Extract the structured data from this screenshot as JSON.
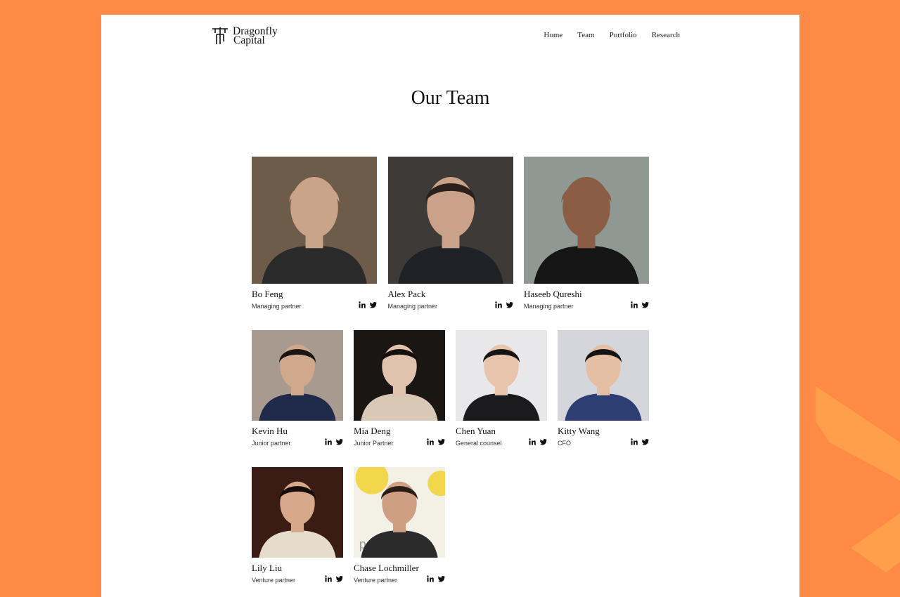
{
  "brand": {
    "line1": "Dragonfly",
    "line2": "Capital"
  },
  "nav": {
    "items": [
      "Home",
      "Team",
      "Portfolio",
      "Research"
    ]
  },
  "page": {
    "title": "Our Team"
  },
  "colors": {
    "background": "#FF8A45",
    "accent_shape": "#FF9F4A",
    "text": "#111111"
  },
  "team": [
    {
      "name": "Bo Feng",
      "role": "Managing partner",
      "photo": {
        "bg": "#6d5c49",
        "skin": "#c9a488",
        "hair": "#c9a488",
        "shirt": "#2a2a2a"
      }
    },
    {
      "name": "Alex Pack",
      "role": "Managing partner",
      "photo": {
        "bg": "#3d3a38",
        "skin": "#caa28a",
        "hair": "#2b201a",
        "shirt": "#1e2126"
      }
    },
    {
      "name": "Haseeb Qureshi",
      "role": "Managing partner",
      "photo": {
        "bg": "#8f9892",
        "skin": "#8a5d44",
        "hair": "#8a5d44",
        "shirt": "#151515"
      }
    },
    {
      "name": "Kevin Hu",
      "role": "Junior partner",
      "photo": {
        "bg": "#a89a8f",
        "skin": "#d0a98c",
        "hair": "#1a1512",
        "shirt": "#1f2a4a"
      }
    },
    {
      "name": "Mia Deng",
      "role": "Junior Partner",
      "photo": {
        "bg": "#1a1614",
        "skin": "#e0c2ad",
        "hair": "#14100e",
        "shirt": "#d9c8b5"
      }
    },
    {
      "name": "Chen Yuan",
      "role": "General counsel",
      "photo": {
        "bg": "#e8e8ea",
        "skin": "#e7c4ab",
        "hair": "#141414",
        "shirt": "#1b1b1e"
      }
    },
    {
      "name": "Kitty Wang",
      "role": "CFO",
      "photo": {
        "bg": "#d4d6dc",
        "skin": "#e4bfa3",
        "hair": "#141414",
        "shirt": "#2d3e72"
      }
    },
    {
      "name": "Lily Liu",
      "role": "Venture partner",
      "photo": {
        "bg": "#3a1c14",
        "skin": "#d7a98a",
        "hair": "#120c0a",
        "shirt": "#e6dccc"
      }
    },
    {
      "name": "Chase Lochmiller",
      "role": "Venture partner",
      "photo": {
        "bg": "#f3f0e6",
        "skin": "#cf9f84",
        "hair": "#2a1d14",
        "shirt": "#2b2b2b",
        "backdrop_text": "powered b"
      }
    }
  ]
}
